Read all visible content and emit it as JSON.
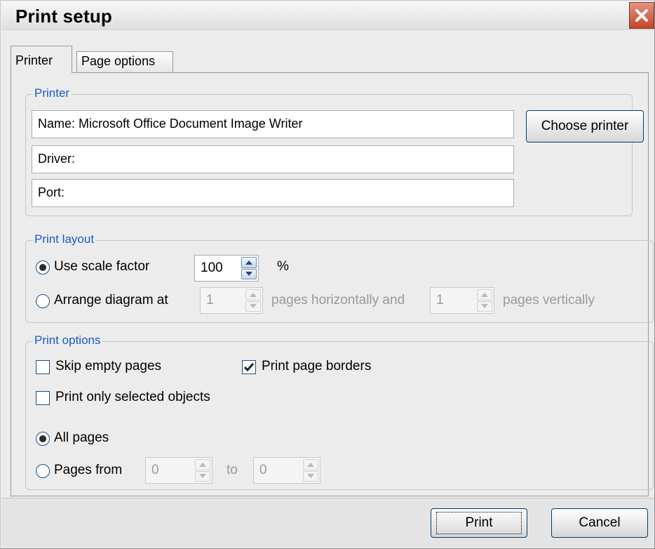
{
  "window": {
    "title": "Print setup",
    "close_icon": "close-icon"
  },
  "tabs": [
    {
      "label": "Printer",
      "active": true
    },
    {
      "label": "Page options",
      "active": false
    }
  ],
  "printer_group": {
    "legend": "Printer",
    "name": "Name: Microsoft Office Document Image Writer",
    "driver": "Driver:",
    "port": "Port:",
    "choose_button": "Choose printer"
  },
  "layout_group": {
    "legend": "Print layout",
    "scale_option": {
      "label": "Use scale factor",
      "selected": true,
      "value": "100",
      "unit": "%"
    },
    "arrange_option": {
      "label": "Arrange diagram at",
      "selected": false,
      "horizontal_value": "1",
      "horizontal_label": "pages horizontally and",
      "vertical_value": "1",
      "vertical_label": "pages vertically"
    }
  },
  "options_group": {
    "legend": "Print options",
    "skip_empty": {
      "label": "Skip empty pages",
      "checked": false
    },
    "page_borders": {
      "label": "Print page borders",
      "checked": true
    },
    "only_selected": {
      "label": "Print only selected objects",
      "checked": false
    },
    "all_pages": {
      "label": "All pages",
      "selected": true
    },
    "pages_from": {
      "label": "Pages from",
      "selected": false,
      "from_value": "0",
      "to_label": "to",
      "to_value": "0"
    }
  },
  "footer": {
    "print_button": "Print",
    "cancel_button": "Cancel"
  },
  "colors": {
    "legend_text": "#1c5ac9",
    "close_button": "#c4452a",
    "window_bg": "#ececec"
  }
}
